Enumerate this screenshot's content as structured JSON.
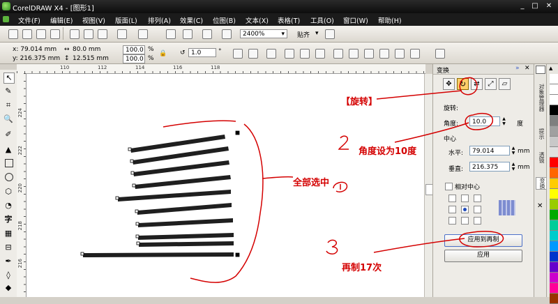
{
  "window": {
    "title": "CorelDRAW X4 - [图形1]"
  },
  "menu": [
    "文件(F)",
    "编辑(E)",
    "视图(V)",
    "版面(L)",
    "排列(A)",
    "效果(C)",
    "位图(B)",
    "文本(X)",
    "表格(T)",
    "工具(O)",
    "窗口(W)",
    "帮助(H)"
  ],
  "toolbar": {
    "zoom": "2400%",
    "snap": "贴齐"
  },
  "property_bar": {
    "x": "x: 79.014 mm",
    "y": "y: 216.375 mm",
    "width": "80.0 mm",
    "height": "12.515 mm",
    "scale_x": "100.0",
    "scale_y": "100.0",
    "percent": "%",
    "angle": "1.0",
    "degree": "°"
  },
  "ruler": {
    "h_ticks": [
      "110",
      "112",
      "114",
      "116",
      "118"
    ],
    "v_ticks": [
      "224",
      "222",
      "220",
      "218",
      "216"
    ]
  },
  "docker": {
    "title": "变换",
    "section": "旋转:",
    "angle_label": "角度:",
    "angle_value": "10.0",
    "angle_unit": "度",
    "center_label": "中心",
    "h_label": "水平:",
    "h_value": "79.014",
    "v_label": "垂直:",
    "v_value": "216.375",
    "unit": "mm",
    "relative_center": "相对中心",
    "apply_dup": "应用到再制",
    "apply": "应用"
  },
  "side_tabs": [
    "对象管理器",
    "提示",
    "透镜",
    "变换"
  ],
  "annotations": {
    "rotate": "【旋转】",
    "step2": "角度设为10度",
    "step1": "全部选中",
    "step3": "再制17次"
  },
  "colors": {
    "annotation": "#d40000",
    "line_fill": "#1f1f1f",
    "selected_btn": "#ff9900"
  },
  "palette": [
    "#ffffff",
    "#000000",
    "#7f7f7f",
    "#a0a0a0",
    "#c8c8c8",
    "#e0e0e0",
    "#ff0000",
    "#ff6600",
    "#ffcc00",
    "#ffff00",
    "#99cc00",
    "#00aa00",
    "#00cc99",
    "#00cccc",
    "#0099ff",
    "#0033cc",
    "#6600cc",
    "#cc00cc",
    "#ff0099",
    "#993300"
  ]
}
